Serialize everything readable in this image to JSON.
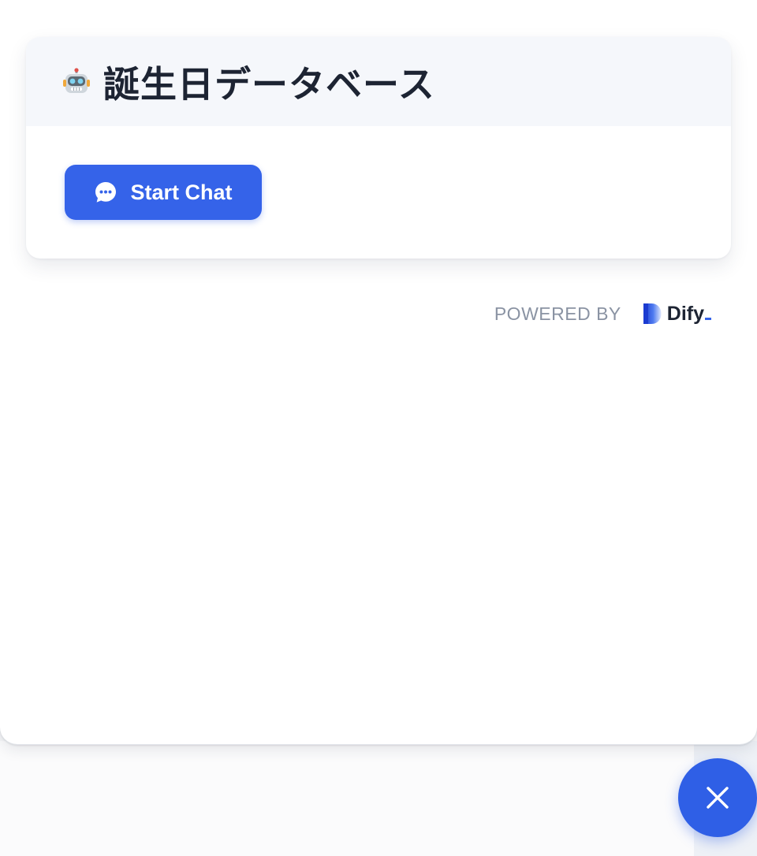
{
  "card": {
    "title": "誕生日データベース",
    "header_icon": "robot-icon"
  },
  "start_chat": {
    "label": "Start Chat",
    "icon": "chat-bubble-icon"
  },
  "footer": {
    "powered_by": "POWERED BY",
    "brand": "Dify"
  },
  "fab": {
    "icon": "close-icon"
  },
  "colors": {
    "accent": "#3563e9",
    "header_bg": "#f5f7fb",
    "title_text": "#1d2433",
    "muted_text": "#8a93a3"
  }
}
